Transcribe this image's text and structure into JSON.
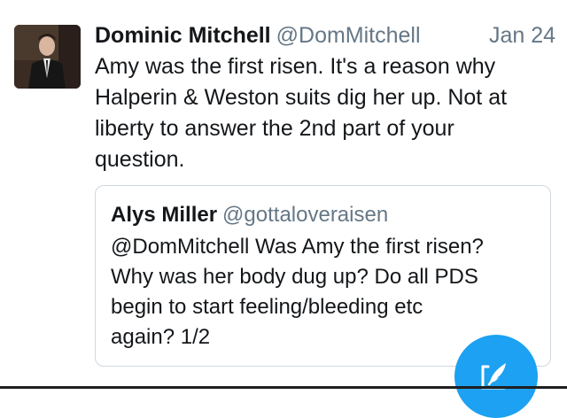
{
  "tweet": {
    "display_name": "Dominic Mitchell",
    "handle": "@DomMitchell",
    "date": "Jan 24",
    "text": "Amy was the first risen. It's a reason why\nHalperin & Weston suits dig her up. Not at\nliberty to answer the 2nd part of your\nquestion."
  },
  "quoted_tweet": {
    "display_name": "Alys Miller",
    "handle": "@gottaloveraisen",
    "text": "@DomMitchell Was Amy the first risen?\nWhy was her body dug up? Do all PDS\nbegin to start feeling/bleeding etc\nagain? 1/2"
  },
  "icons": {
    "avatar": "profile-photo",
    "compose": "compose-tweet-icon"
  },
  "colors": {
    "accent": "#1da1f2",
    "secondary_text": "#657786",
    "primary_text": "#14171a",
    "card_border": "#d0d8de"
  }
}
